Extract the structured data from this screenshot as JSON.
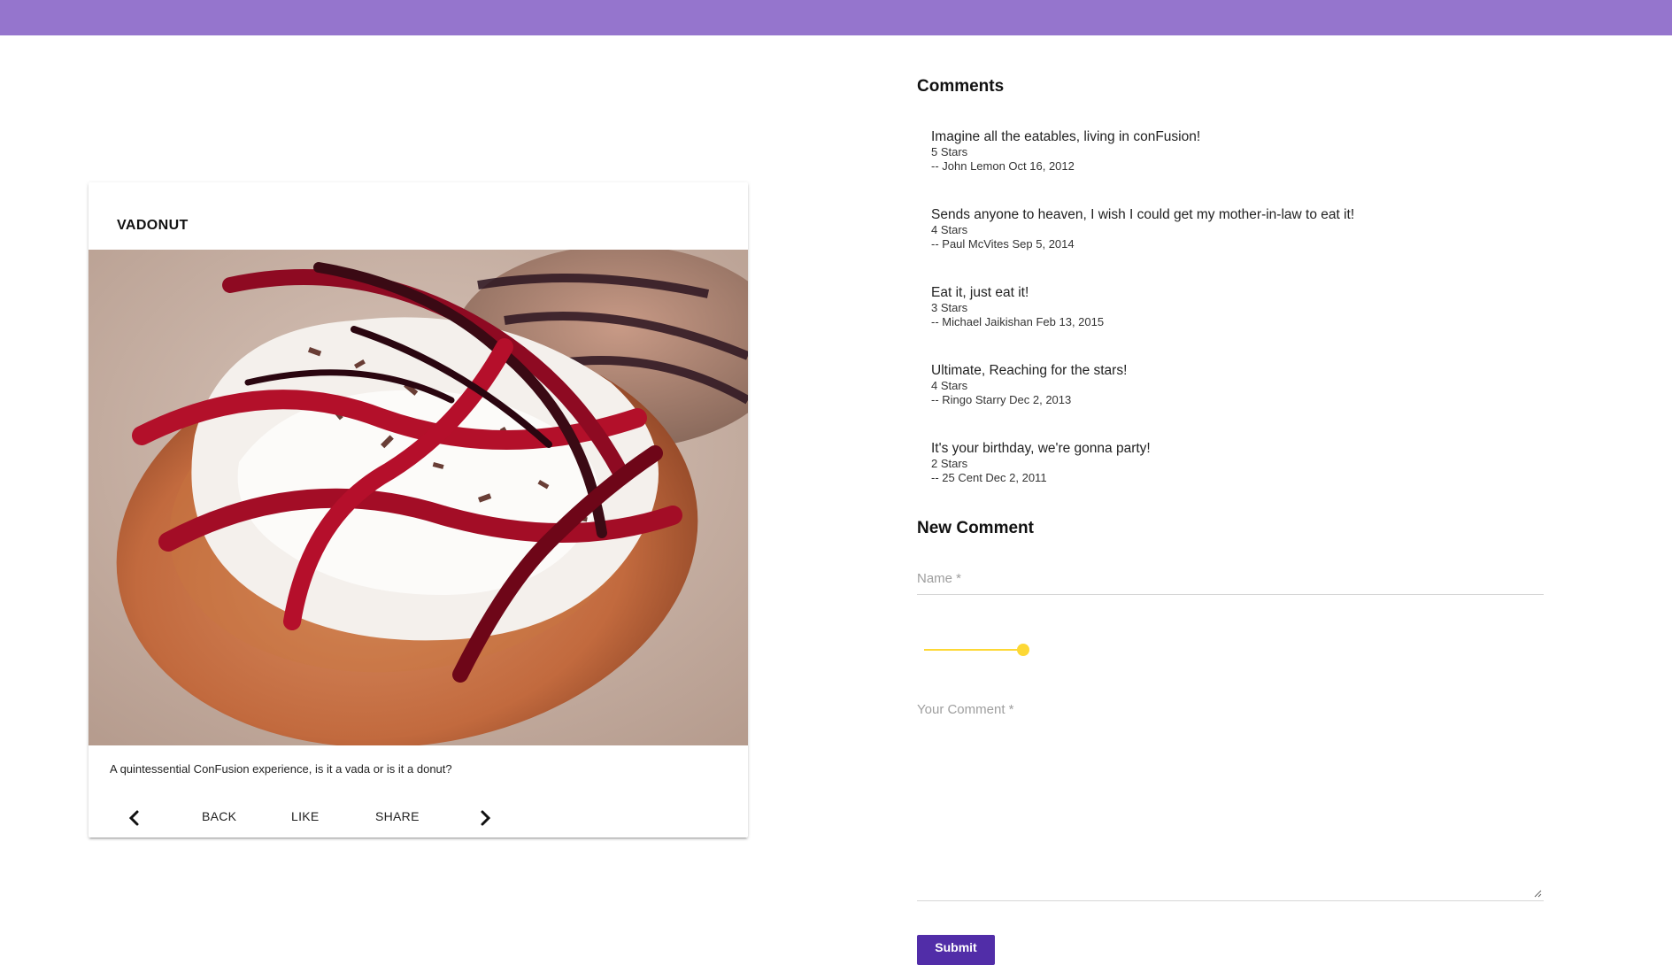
{
  "colors": {
    "toolbar": "#9575cd",
    "accent_slider": "#fdd835",
    "submit_bg": "#512da8"
  },
  "dish": {
    "name": "VADONUT",
    "description": "A quintessential ConFusion experience, is it a vada or is it a donut?",
    "image_alt": "vadonut-photo",
    "actions": {
      "prev_icon": "chevron-left-icon",
      "back": "BACK",
      "like": "LIKE",
      "share": "SHARE",
      "next_icon": "chevron-right-icon"
    }
  },
  "comments": {
    "title": "Comments",
    "items": [
      {
        "text": "Imagine all the eatables, living in conFusion!",
        "rating": "5 Stars",
        "byline": "-- John Lemon Oct 16, 2012"
      },
      {
        "text": "Sends anyone to heaven, I wish I could get my mother-in-law to eat it!",
        "rating": "4 Stars",
        "byline": "-- Paul McVites Sep 5, 2014"
      },
      {
        "text": "Eat it, just eat it!",
        "rating": "3 Stars",
        "byline": "-- Michael Jaikishan Feb 13, 2015"
      },
      {
        "text": "Ultimate, Reaching for the stars!",
        "rating": "4 Stars",
        "byline": "-- Ringo Starry Dec 2, 2013"
      },
      {
        "text": "It's your birthday, we're gonna party!",
        "rating": "2 Stars",
        "byline": "-- 25 Cent Dec 2, 2011"
      }
    ]
  },
  "new_comment": {
    "title": "New Comment",
    "name_placeholder": "Name *",
    "name_value": "",
    "rating_value": 5,
    "rating_max": 5,
    "comment_placeholder": "Your Comment *",
    "comment_value": "",
    "submit_label": "Submit"
  }
}
